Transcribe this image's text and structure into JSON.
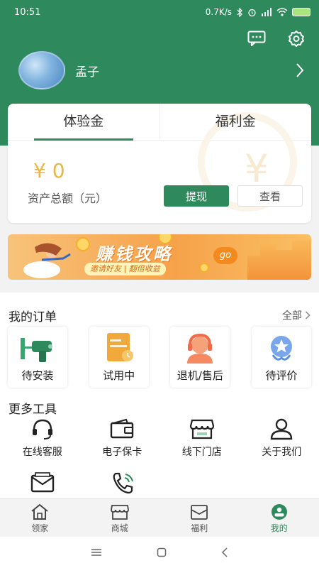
{
  "status_bar": {
    "time": "10:51",
    "network_speed": "0.7K/s",
    "icons": [
      "bluetooth-icon",
      "alarm-icon",
      "signal-icon",
      "wifi-icon",
      "battery-icon"
    ]
  },
  "header": {
    "icons": [
      "message-icon",
      "settings-icon"
    ],
    "username": "孟子"
  },
  "wallet": {
    "tabs": [
      {
        "label": "体验金",
        "active": true
      },
      {
        "label": "福利金",
        "active": false
      }
    ],
    "amount": "¥ 0",
    "amount_label": "资产总额（元）",
    "withdraw_label": "提现",
    "view_label": "查看"
  },
  "banner": {
    "title": "赚钱攻略",
    "subtitle": "邀请好友 | 翻倍收益",
    "badge": "go"
  },
  "orders": {
    "title": "我的订单",
    "all_label": "全部",
    "items": [
      {
        "label": "待安装",
        "icon": "drill-icon"
      },
      {
        "label": "试用中",
        "icon": "trial-card-icon"
      },
      {
        "label": "退机/售后",
        "icon": "service-agent-icon"
      },
      {
        "label": "待评价",
        "icon": "rating-star-icon"
      }
    ]
  },
  "tools": {
    "title": "更多工具",
    "items": [
      {
        "label": "在线客服",
        "icon": "headset-icon"
      },
      {
        "label": "电子保卡",
        "icon": "wallet-icon"
      },
      {
        "label": "线下门店",
        "icon": "store-icon"
      },
      {
        "label": "关于我们",
        "icon": "user-icon"
      }
    ],
    "row2_icons": [
      "mail-icon",
      "phone-icon"
    ]
  },
  "tabbar": {
    "items": [
      {
        "label": "领家",
        "icon": "home-icon",
        "active": false
      },
      {
        "label": "商城",
        "icon": "shop-icon",
        "active": false
      },
      {
        "label": "福利",
        "icon": "envelope-icon",
        "active": false
      },
      {
        "label": "我的",
        "icon": "profile-icon",
        "active": true
      }
    ]
  },
  "colors": {
    "brand_green": "#2e8a5c",
    "amount_gold": "#e8b64a",
    "banner_orange": "#f6a24a"
  }
}
